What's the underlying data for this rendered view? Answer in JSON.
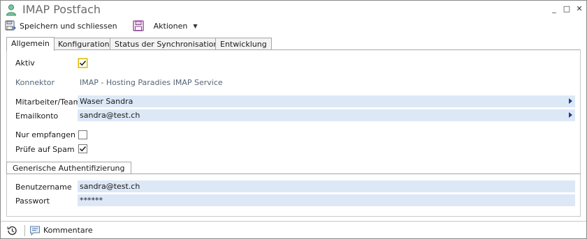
{
  "window": {
    "title": "IMAP Postfach",
    "controls": [
      "_",
      "□",
      "✕"
    ]
  },
  "toolbar": {
    "save_close_label": "Speichern und schliessen",
    "actions_label": "Aktionen"
  },
  "tabs": [
    {
      "label": "Allgemein",
      "active": true
    },
    {
      "label": "Konfiguration",
      "active": false
    },
    {
      "label": "Status der Synchronisation",
      "active": false
    },
    {
      "label": "Entwicklung",
      "active": false
    }
  ],
  "form": {
    "aktiv_label": "Aktiv",
    "aktiv_checked": true,
    "konnektor_label": "Konnektor",
    "konnektor_value": "IMAP - Hosting Paradies IMAP Service",
    "mitarbeiter_label": "Mitarbeiter/Team",
    "mitarbeiter_value": "Waser Sandra",
    "emailkonto_label": "Emailkonto",
    "emailkonto_value": "sandra@test.ch",
    "nur_empfangen_label": "Nur empfangen",
    "nur_empfangen_checked": false,
    "spam_label": "Prüfe auf Spam",
    "spam_checked": true
  },
  "auth": {
    "section_label": "Generische Authentifizierung",
    "username_label": "Benutzername",
    "username_value": "sandra@test.ch",
    "password_label": "Passwort",
    "password_value": "******"
  },
  "bottom": {
    "comments_label": "Kommentare"
  },
  "colors": {
    "field_bg": "#dde8f7",
    "accent_arrow": "#1f3f7f",
    "title_text": "#6b6b6b"
  }
}
